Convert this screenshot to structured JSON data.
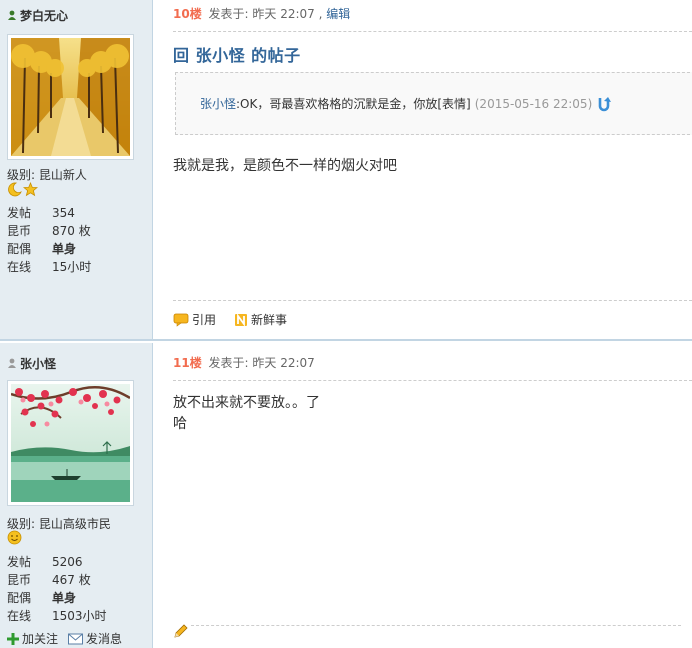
{
  "posts": [
    {
      "user": {
        "name": "梦白无心",
        "level_label": "级别:",
        "level": "昆山新人"
      },
      "stats": [
        {
          "k": "发帖",
          "v": "354",
          "bold": false
        },
        {
          "k": "昆币",
          "v": "870 枚",
          "bold": false
        },
        {
          "k": "配偶",
          "v": "单身",
          "bold": true
        },
        {
          "k": "在线",
          "v": "15小时",
          "bold": false
        }
      ],
      "floor": "10楼",
      "posted": "发表于: 昨天 22:07 ,",
      "edit": "编辑",
      "title": "回 张小怪 的帖子",
      "quote": {
        "user": "张小怪",
        "text": ":OK，哥最喜欢格格的沉默是金，你放[表情]",
        "date": "(2015-05-16 22:05)"
      },
      "content": [
        "我就是我，是颜色不一样的烟火对吧"
      ],
      "actions": {
        "quote": "引用",
        "news": "新鲜事"
      }
    },
    {
      "user": {
        "name": "张小怪",
        "level_label": "级别:",
        "level": "昆山高级市民"
      },
      "stats": [
        {
          "k": "发帖",
          "v": "5206",
          "bold": false
        },
        {
          "k": "昆币",
          "v": "467 枚",
          "bold": false
        },
        {
          "k": "配偶",
          "v": "单身",
          "bold": true
        },
        {
          "k": "在线",
          "v": "1503小时",
          "bold": false
        }
      ],
      "floor": "11楼",
      "posted": "发表于: 昨天 22:07",
      "content": [
        "放不出来就不要放。。了",
        "哈"
      ],
      "user_actions": {
        "follow": "加关注",
        "message": "发消息"
      }
    }
  ],
  "colors": {
    "link": "#336699",
    "floor": "#f26c4f",
    "sidebar": "#e5edf2"
  }
}
